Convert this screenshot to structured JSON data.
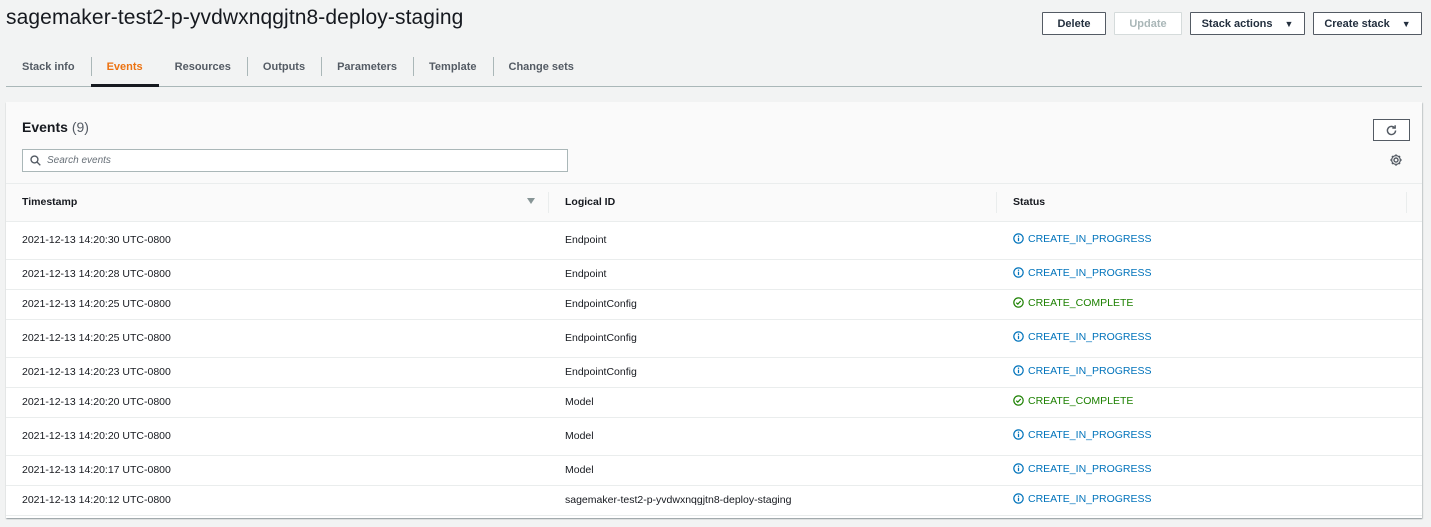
{
  "header": {
    "title": "sagemaker-test2-p-yvdwxnqgjtn8-deploy-staging",
    "buttons": {
      "delete": "Delete",
      "update": "Update",
      "stack_actions": "Stack actions",
      "create_stack": "Create stack"
    }
  },
  "tabs": [
    {
      "label": "Stack info",
      "active": false
    },
    {
      "label": "Events",
      "active": true
    },
    {
      "label": "Resources",
      "active": false
    },
    {
      "label": "Outputs",
      "active": false
    },
    {
      "label": "Parameters",
      "active": false
    },
    {
      "label": "Template",
      "active": false
    },
    {
      "label": "Change sets",
      "active": false
    }
  ],
  "events": {
    "title": "Events",
    "count": "(9)",
    "search_placeholder": "Search events",
    "columns": {
      "timestamp": "Timestamp",
      "logical_id": "Logical ID",
      "status": "Status"
    },
    "rows": [
      {
        "timestamp": "2021-12-13 14:20:30 UTC-0800",
        "logical_id": "Endpoint",
        "status": "CREATE_IN_PROGRESS"
      },
      {
        "timestamp": "2021-12-13 14:20:28 UTC-0800",
        "logical_id": "Endpoint",
        "status": "CREATE_IN_PROGRESS"
      },
      {
        "timestamp": "2021-12-13 14:20:25 UTC-0800",
        "logical_id": "EndpointConfig",
        "status": "CREATE_COMPLETE"
      },
      {
        "timestamp": "2021-12-13 14:20:25 UTC-0800",
        "logical_id": "EndpointConfig",
        "status": "CREATE_IN_PROGRESS"
      },
      {
        "timestamp": "2021-12-13 14:20:23 UTC-0800",
        "logical_id": "EndpointConfig",
        "status": "CREATE_IN_PROGRESS"
      },
      {
        "timestamp": "2021-12-13 14:20:20 UTC-0800",
        "logical_id": "Model",
        "status": "CREATE_COMPLETE"
      },
      {
        "timestamp": "2021-12-13 14:20:20 UTC-0800",
        "logical_id": "Model",
        "status": "CREATE_IN_PROGRESS"
      },
      {
        "timestamp": "2021-12-13 14:20:17 UTC-0800",
        "logical_id": "Model",
        "status": "CREATE_IN_PROGRESS"
      },
      {
        "timestamp": "2021-12-13 14:20:12 UTC-0800",
        "logical_id": "sagemaker-test2-p-yvdwxnqgjtn8-deploy-staging",
        "status": "CREATE_IN_PROGRESS"
      }
    ]
  },
  "colors": {
    "active_tab": "#ec7211",
    "status_in_progress": "#0073bb",
    "status_complete": "#1d8102"
  },
  "icons": {
    "search": "search-icon",
    "refresh": "refresh-icon",
    "settings": "gear-icon",
    "sort": "sort-down-icon",
    "in_progress": "info-circle-icon",
    "complete": "check-circle-icon"
  }
}
